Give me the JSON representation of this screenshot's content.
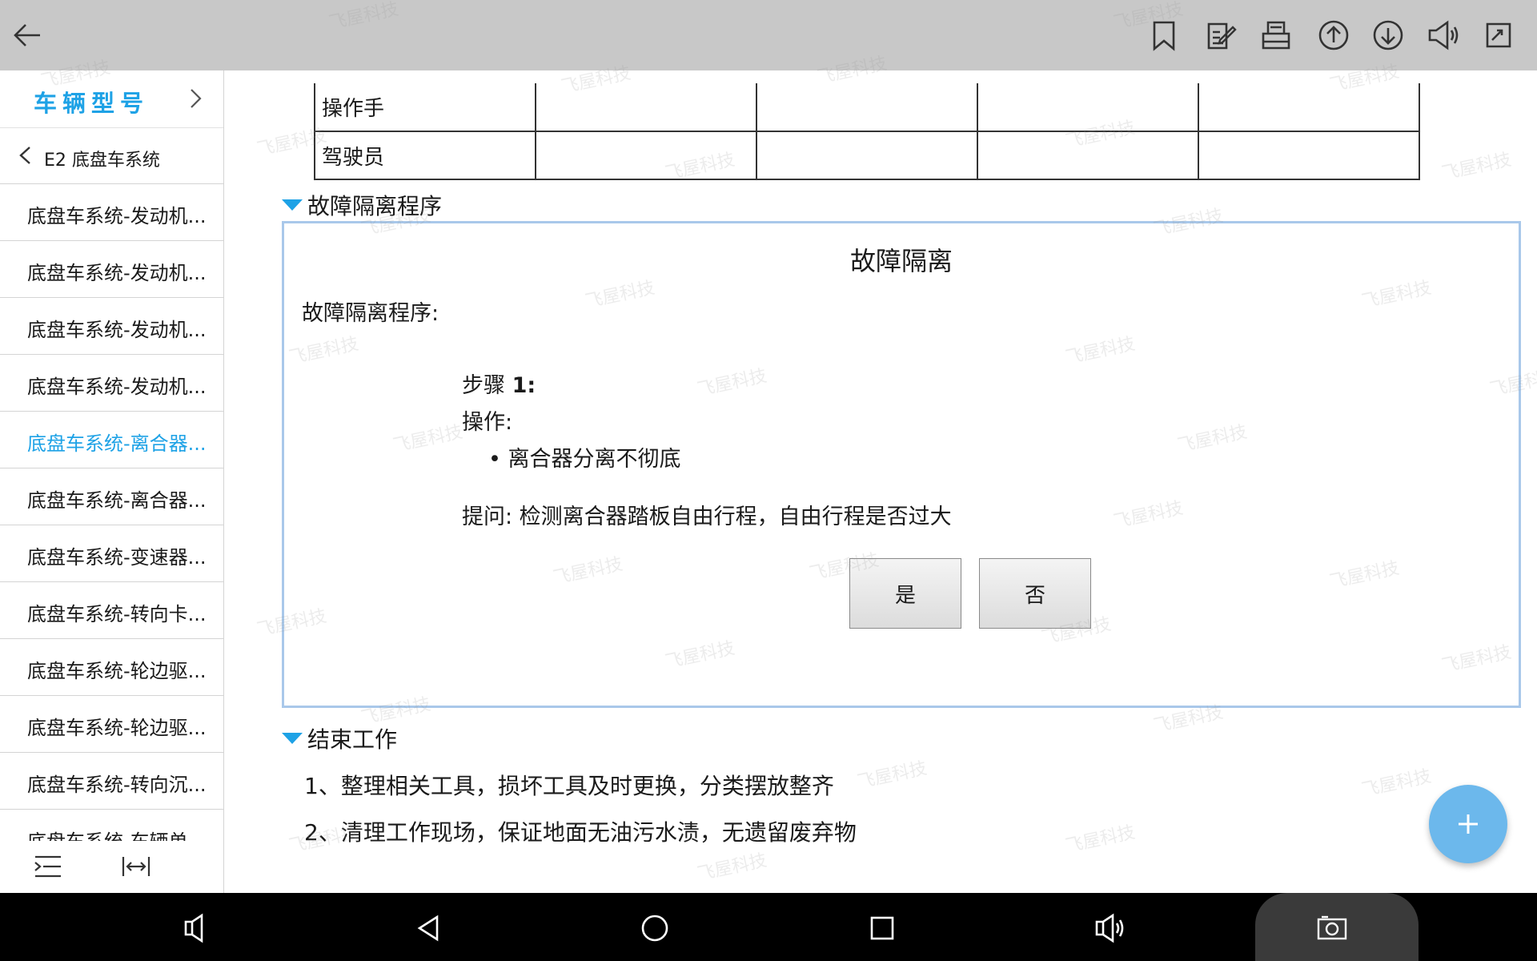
{
  "toolbar": {
    "back_icon": "arrow-left-icon",
    "icons": [
      "bookmark-icon",
      "note-edit-icon",
      "print-icon",
      "page-up-icon",
      "page-down-icon",
      "speaker-icon",
      "fullscreen-icon"
    ]
  },
  "sidebar": {
    "header_title": "车辆型号",
    "sub_title": "E2 底盘车系统",
    "items": [
      {
        "label": "底盘车系统-发动机..."
      },
      {
        "label": "底盘车系统-发动机..."
      },
      {
        "label": "底盘车系统-发动机..."
      },
      {
        "label": "底盘车系统-发动机..."
      },
      {
        "label": "底盘车系统-离合器..."
      },
      {
        "label": "底盘车系统-离合器..."
      },
      {
        "label": "底盘车系统-变速器..."
      },
      {
        "label": "底盘车系统-转向卡..."
      },
      {
        "label": "底盘车系统-轮边驱..."
      },
      {
        "label": "底盘车系统-轮边驱..."
      },
      {
        "label": "底盘车系统-转向沉..."
      },
      {
        "label": "底盘车系统-车辆单"
      }
    ],
    "active_index": 4
  },
  "content": {
    "table_rows": [
      [
        "操作手",
        "",
        "",
        "",
        ""
      ],
      [
        "驾驶员",
        "",
        "",
        "",
        ""
      ]
    ],
    "section_isolation": "故障隔离程序",
    "isolation_box": {
      "title": "故障隔离",
      "label": "故障隔离程序:",
      "step_prefix": "步骤 ",
      "step_number": "1:",
      "operation_label": "操作:",
      "bullet": "• 离合器分离不彻底",
      "question": "提问: 检测离合器踏板自由行程，自由行程是否过大",
      "yes_label": "是",
      "no_label": "否"
    },
    "section_end": "结束工作",
    "end_lines": [
      "1、整理相关工具，损坏工具及时更换，分类摆放整齐",
      "2、清理工作现场，保证地面无油污水渍，无遗留废弃物"
    ]
  },
  "watermark": "飞屋科技",
  "colors": {
    "accent": "#1ea2e6",
    "topbar": "#c8c8c8",
    "box_border": "#a9c8ea",
    "fab": "#6cb8ec",
    "navbar": "#000000"
  }
}
